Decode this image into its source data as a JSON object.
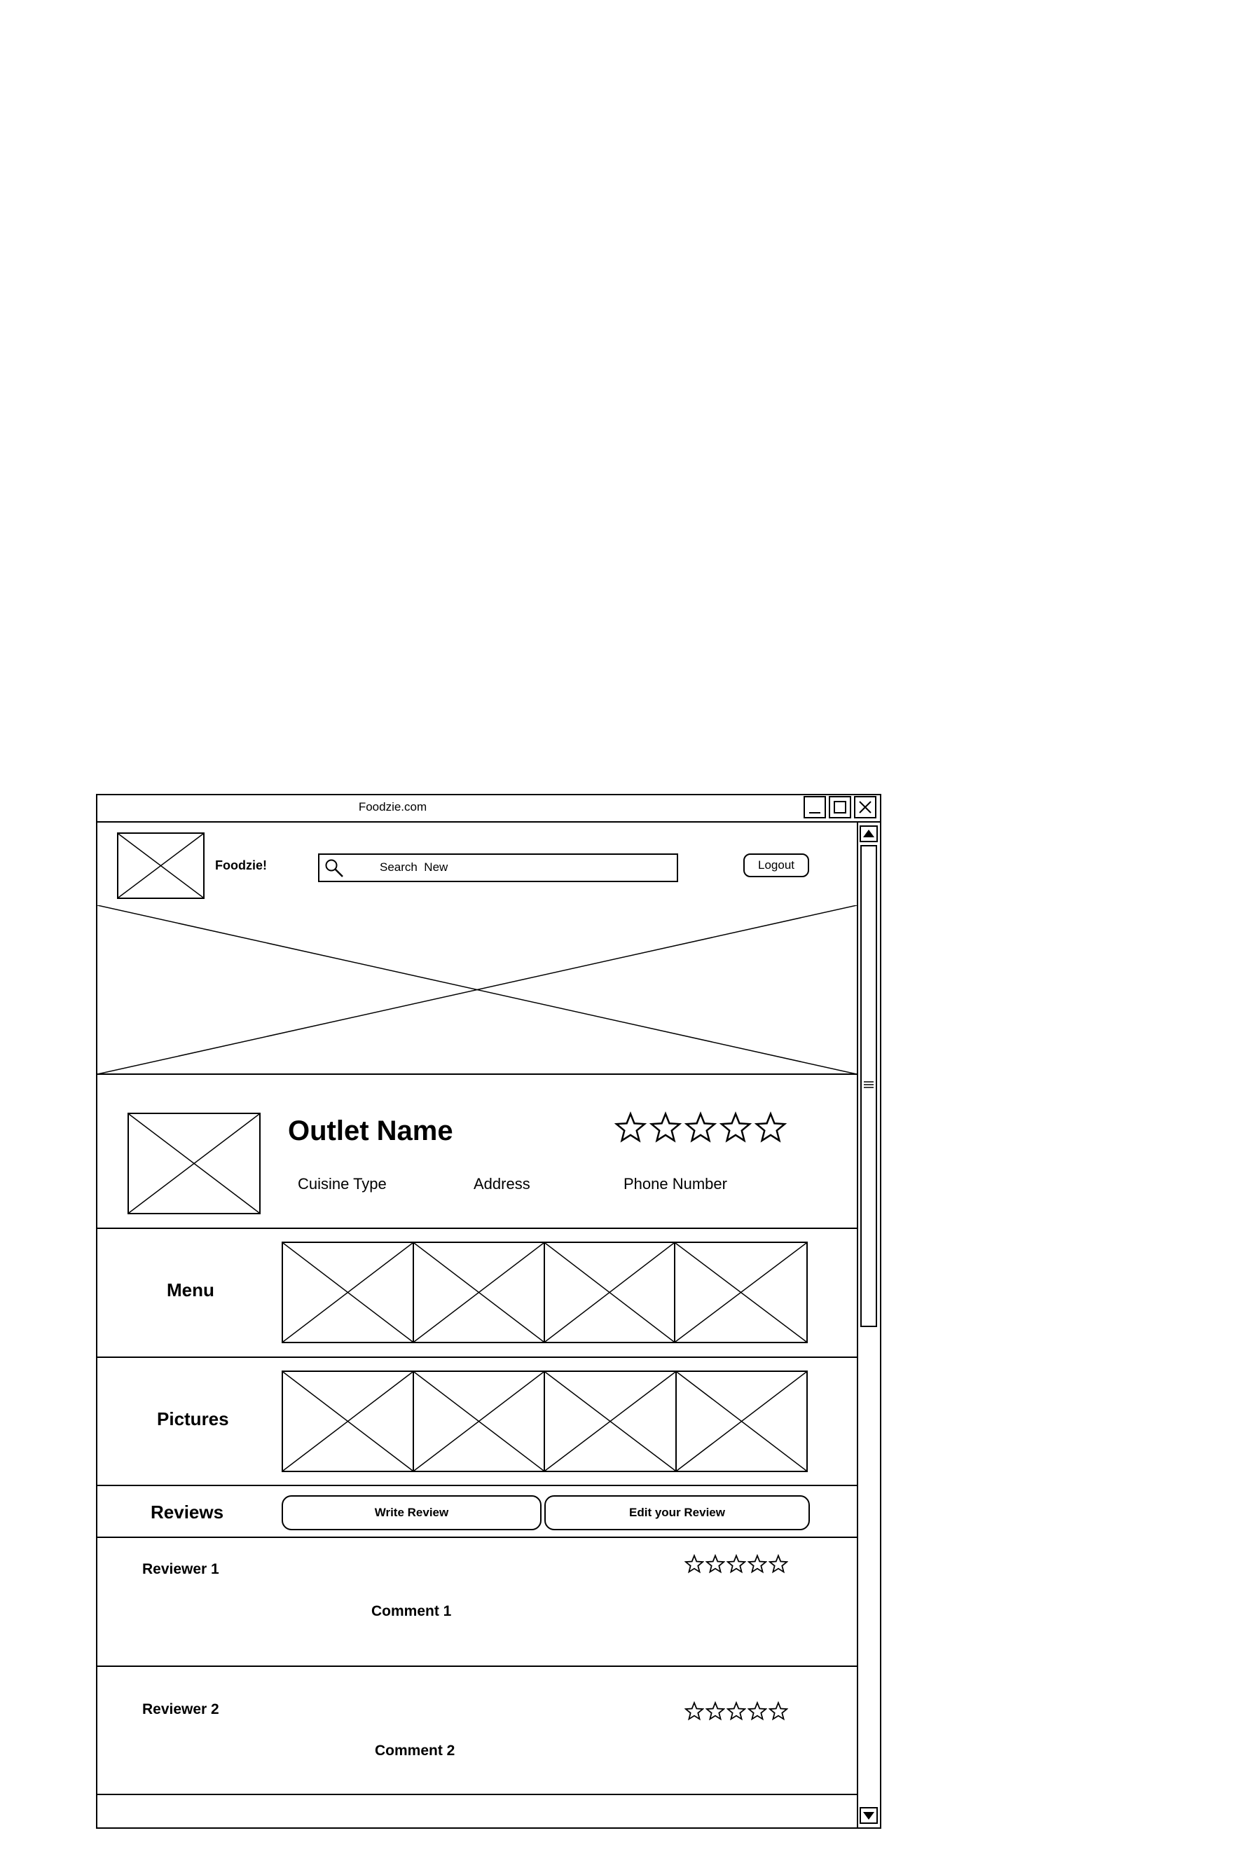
{
  "window": {
    "title": "Foodzie.com",
    "controls": [
      "minimize-icon",
      "maximize-icon",
      "close-icon"
    ]
  },
  "header": {
    "logo_placeholder": "image-placeholder",
    "brand": "Foodzie!",
    "search": {
      "text": "Search  New",
      "icon": "search-icon"
    },
    "logout_label": "Logout"
  },
  "outlet": {
    "name": "Outlet Name",
    "rating": {
      "filled": 0,
      "max": 5
    },
    "cuisine_label": "Cuisine Type",
    "address_label": "Address",
    "phone_label": "Phone Number"
  },
  "sections": {
    "menu_label": "Menu",
    "pictures_label": "Pictures",
    "reviews_label": "Reviews"
  },
  "review_actions": {
    "write_label": "Write Review",
    "edit_label": "Edit your Review"
  },
  "reviews": [
    {
      "reviewer": "Reviewer 1",
      "comment": "Comment 1",
      "rating": {
        "filled": 0,
        "max": 5
      }
    },
    {
      "reviewer": "Reviewer 2",
      "comment": "Comment 2",
      "rating": {
        "filled": 0,
        "max": 5
      }
    }
  ],
  "scrollbar": {
    "up_icon": "arrow-up-icon",
    "down_icon": "arrow-down-icon",
    "grip_icon": "grip-icon"
  },
  "colors": {
    "stroke": "#000000",
    "background": "#ffffff"
  }
}
